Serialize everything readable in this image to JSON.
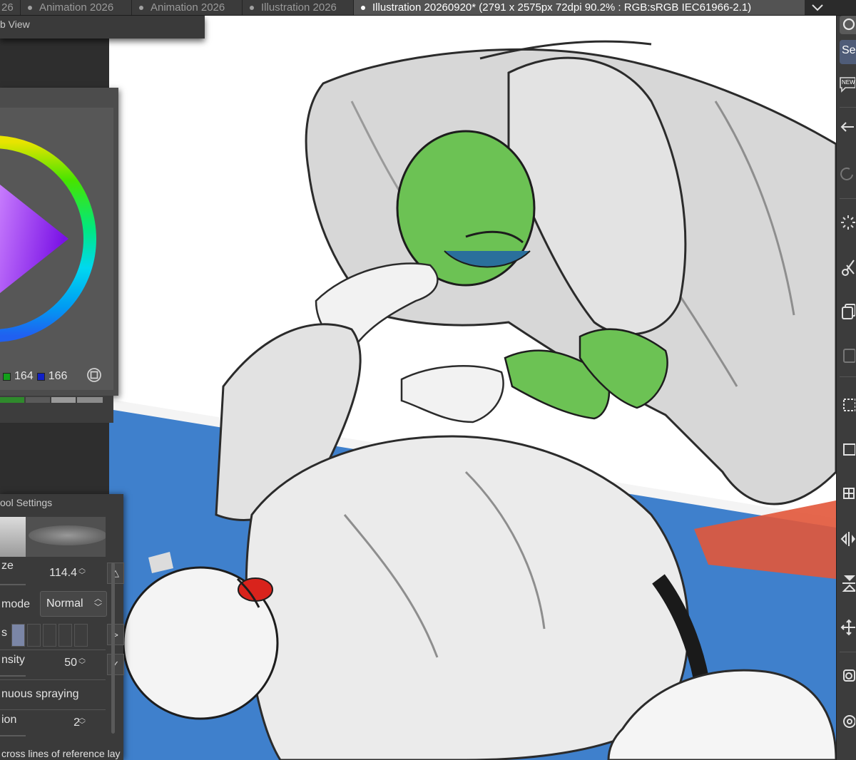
{
  "tabs": [
    {
      "label": "Animation 2026"
    },
    {
      "label": "Animation 2026"
    },
    {
      "label": "Illustration 2026"
    },
    {
      "label": "Illustration 20260920* (2791 x 2575px 72dpi 90.2% : RGB:sRGB IEC61966-2.1)",
      "active": true
    }
  ],
  "tab_prefix": "26",
  "subview_title": "b View",
  "color": {
    "g_value": "164",
    "b_value": "166",
    "g_swatch": "#12a01a",
    "b_swatch": "#1020c8"
  },
  "tool_settings": {
    "header": "ool Settings",
    "size_label": "ze",
    "size_value": "114.4",
    "mode_label": "mode",
    "mode_value": "Normal",
    "s_label": "s",
    "density_label": "nsity",
    "density_value": "50",
    "continuous_label": "nuous spraying",
    "ion_label": "ion",
    "ion_value": "2",
    "reference_label": "cross lines of reference lay"
  },
  "right_toolbar": {
    "search_tab": "Se",
    "new_badge": "NEW"
  },
  "colors": {
    "accent": "#4f5c78",
    "mat_blue": "#3f80cc",
    "mat_red": "#e2573a",
    "character_green": "#6cc254"
  }
}
